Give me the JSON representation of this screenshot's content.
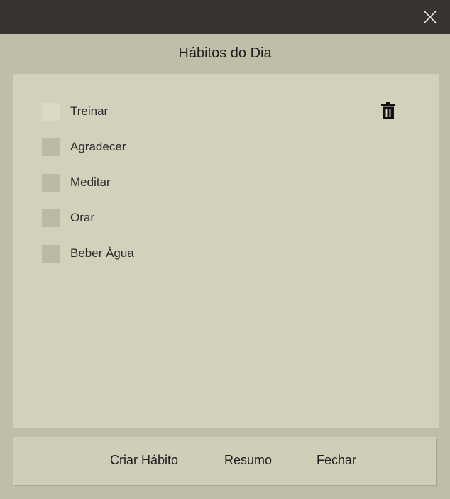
{
  "window": {
    "close_icon": "close-icon"
  },
  "page": {
    "title": "Hábitos do Dia"
  },
  "habits": [
    {
      "label": "Treinar",
      "checked": false,
      "hovered": true
    },
    {
      "label": "Agradecer",
      "checked": false
    },
    {
      "label": "Meditar",
      "checked": false
    },
    {
      "label": "Orar",
      "checked": false
    },
    {
      "label": "Beber Àgua",
      "checked": false
    }
  ],
  "row_actions": {
    "delete_icon": "trash-icon"
  },
  "footer": {
    "create_label": "Criar Hábito",
    "summary_label": "Resumo",
    "close_label": "Fechar"
  },
  "colors": {
    "titlebar": "#383530",
    "background": "#bfbea8",
    "panel": "#d3d0bc",
    "checkbox": "#bcb9a6"
  }
}
